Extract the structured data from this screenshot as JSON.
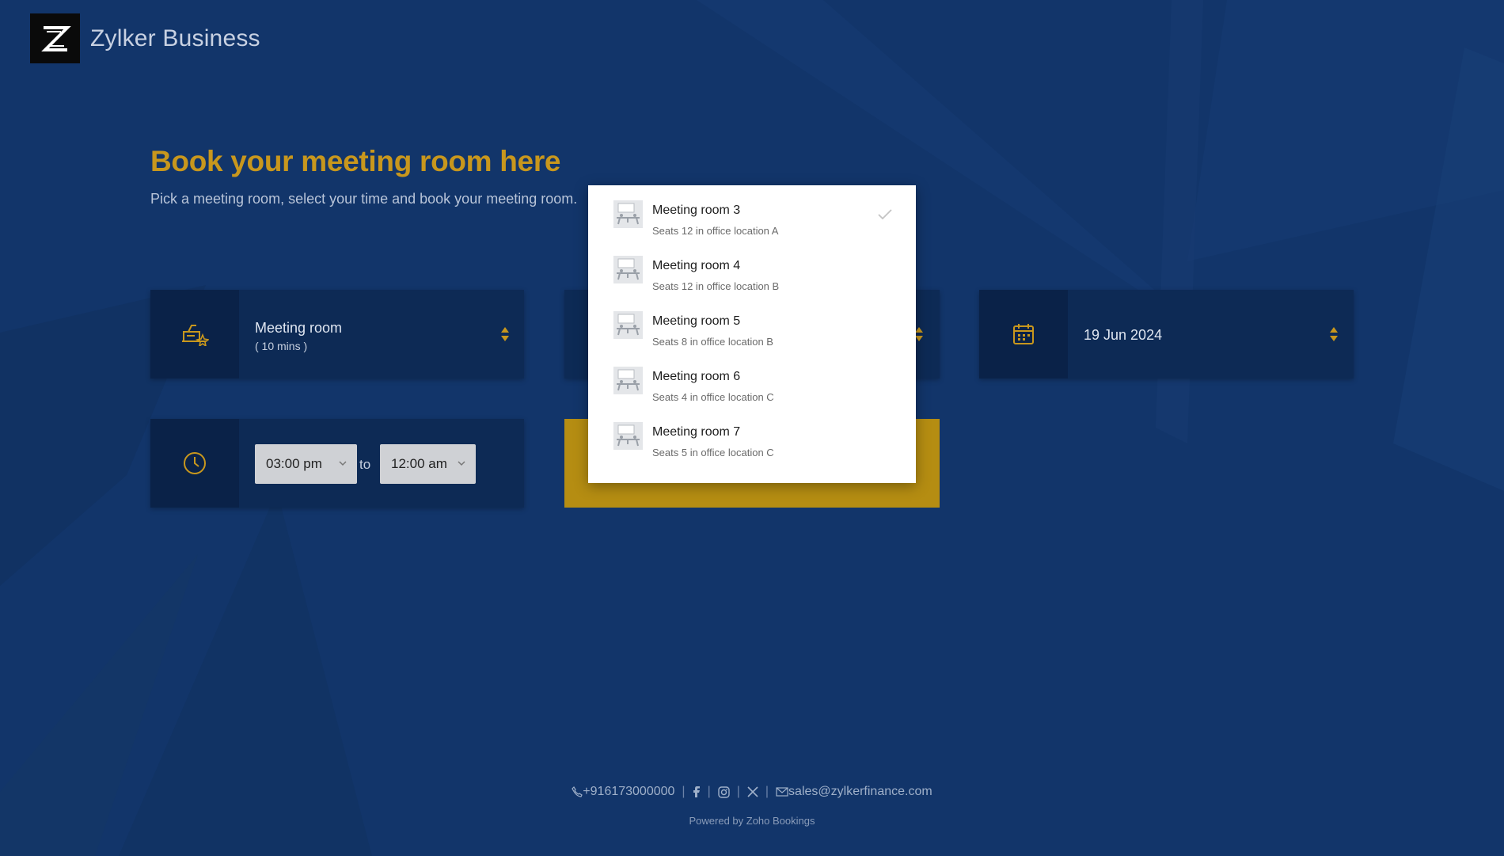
{
  "brand": {
    "name": "Zylker Business"
  },
  "page": {
    "title": "Book your meeting room here",
    "subtitle": "Pick a meeting room, select your time and book your meeting room."
  },
  "service": {
    "title": "Meeting room",
    "duration": "( 10 mins )"
  },
  "date": {
    "value": "19 Jun 2024"
  },
  "time": {
    "start": "03:00 pm",
    "to_label": "to",
    "end": "12:00 am"
  },
  "dropdown": {
    "selected_index": 0,
    "options": [
      {
        "name": "Meeting room 3",
        "desc": "Seats 12 in office location A"
      },
      {
        "name": "Meeting room 4",
        "desc": "Seats 12 in office location B"
      },
      {
        "name": "Meeting room 5",
        "desc": "Seats 8 in office location B"
      },
      {
        "name": "Meeting room 6",
        "desc": "Seats 4 in office location C"
      },
      {
        "name": "Meeting room 7",
        "desc": "Seats 5 in office location C"
      }
    ]
  },
  "footer": {
    "phone": "+916173000000",
    "separator": "|",
    "email": "sales@zylkerfinance.com",
    "powered_by": "Powered by Zoho Bookings",
    "icons": [
      "phone-icon",
      "facebook-icon",
      "instagram-icon",
      "x-icon",
      "mail-icon"
    ]
  },
  "colors": {
    "background": "#12356a",
    "panel": "#0d2a55",
    "accent_gold": "#c8971d",
    "button_gold": "#b58d12"
  }
}
